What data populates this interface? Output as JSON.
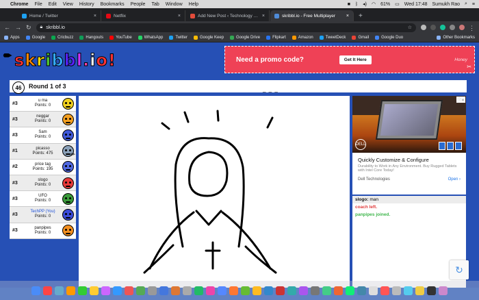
{
  "menubar": {
    "app": "Chrome",
    "items": [
      "File",
      "Edit",
      "View",
      "History",
      "Bookmarks",
      "People",
      "Tab",
      "Window",
      "Help"
    ],
    "battery": "61%",
    "clock": "Wed 17:48",
    "user": "Sumukh Rao"
  },
  "tabs": [
    {
      "title": "Home / Twitter",
      "color": "#1da1f2",
      "active": false
    },
    {
      "title": "Netflix",
      "color": "#e50914",
      "active": false
    },
    {
      "title": "Add New Post ‹ Technology Per",
      "color": "#e34c3b",
      "active": false
    },
    {
      "title": "skribbl.io - Free Multiplayer",
      "color": "#4f8bd8",
      "active": true
    }
  ],
  "address": {
    "url": "skribbl.io"
  },
  "bookmarks": [
    {
      "label": "Apps",
      "color": "#8ab4f8"
    },
    {
      "label": "Google",
      "color": "#4285f4"
    },
    {
      "label": "Cricbuzz",
      "color": "#0aa84f"
    },
    {
      "label": "Hangouts",
      "color": "#0f9d58"
    },
    {
      "label": "YouTube",
      "color": "#ff0000"
    },
    {
      "label": "WhatsApp",
      "color": "#25d366"
    },
    {
      "label": "Twitter",
      "color": "#1da1f2"
    },
    {
      "label": "Google Keep",
      "color": "#fbbc04"
    },
    {
      "label": "Google Drive",
      "color": "#34a853"
    },
    {
      "label": "Flipkart",
      "color": "#2874f0"
    },
    {
      "label": "Amazon",
      "color": "#ff9900"
    },
    {
      "label": "TweetDeck",
      "color": "#1da1f2"
    },
    {
      "label": "Gmail",
      "color": "#ea4335"
    },
    {
      "label": "Google Duo",
      "color": "#4285f4"
    }
  ],
  "other_bookmarks": "Other Bookmarks",
  "game": {
    "logo": "skribbl.io!",
    "logo_colors": [
      "#f33",
      "#f80",
      "#fd0",
      "#5c3",
      "#3af",
      "#52f",
      "#c3f",
      "#f4a",
      "#fff",
      "#f33"
    ],
    "timer": "46",
    "round": "Round 1 of 3",
    "word_hint": "_ _ _",
    "players": [
      {
        "rank": "#3",
        "name": "u ma",
        "points": "Points: 0",
        "color": "#f0d020",
        "you": false,
        "drawing": false
      },
      {
        "rank": "#3",
        "name": "neggar",
        "points": "Points: 0",
        "color": "#f4a020",
        "you": false,
        "drawing": false
      },
      {
        "rank": "#3",
        "name": "Sam",
        "points": "Points: 0",
        "color": "#3f58d8",
        "you": false,
        "drawing": false
      },
      {
        "rank": "#1",
        "name": "picasso",
        "points": "Points: 475",
        "color": "#8aa0b8",
        "you": false,
        "drawing": true
      },
      {
        "rank": "#2",
        "name": "price tag",
        "points": "Points: 195",
        "color": "#5068e0",
        "you": false,
        "drawing": false
      },
      {
        "rank": "#3",
        "name": "slogo",
        "points": "Points: 0",
        "color": "#e83a3a",
        "you": false,
        "drawing": false
      },
      {
        "rank": "#3",
        "name": "UFO",
        "points": "Points: 0",
        "color": "#3a9a3a",
        "you": false,
        "drawing": false
      },
      {
        "rank": "#3",
        "name": "TechPP (You)",
        "points": "Points: 0",
        "color": "#3a4ad8",
        "you": true,
        "drawing": false
      },
      {
        "rank": "#3",
        "name": "panpipes",
        "points": "Points: 0",
        "color": "#f49020",
        "you": false,
        "drawing": false
      }
    ],
    "chat": [
      {
        "who": "slogo:",
        "text": "man",
        "style": "gray"
      },
      {
        "who": "",
        "text": "coach left.",
        "style": "red"
      },
      {
        "who": "",
        "text": "panpipes joined.",
        "style": "green"
      }
    ]
  },
  "promo": {
    "title": "Need a promo code?",
    "button": "Get It Here",
    "brand": "Honey"
  },
  "sidead": {
    "brand": "DELL",
    "title": "Quickly Customize & Configure",
    "desc": "Durability to Work in Any Environment. Buy Rugged Tablets with Intel Core Today!",
    "advertiser": "Dell Technologies",
    "cta": "Open"
  },
  "dock_colors": [
    "#4a8cf7",
    "#f44",
    "#6ac",
    "#f90",
    "#3c3",
    "#fc3",
    "#c6f",
    "#39f",
    "#e55",
    "#5a5",
    "#999",
    "#47d",
    "#d73",
    "#aaa",
    "#2b6",
    "#e4a",
    "#58f",
    "#f73",
    "#6b3",
    "#fb2",
    "#38c",
    "#c33",
    "#3aa",
    "#a5e",
    "#777",
    "#4c8",
    "#e63",
    "#1e7",
    "#48a",
    "#ddd",
    "#f55",
    "#bbb",
    "#5ce",
    "#ec4",
    "#333",
    "#c8c"
  ]
}
